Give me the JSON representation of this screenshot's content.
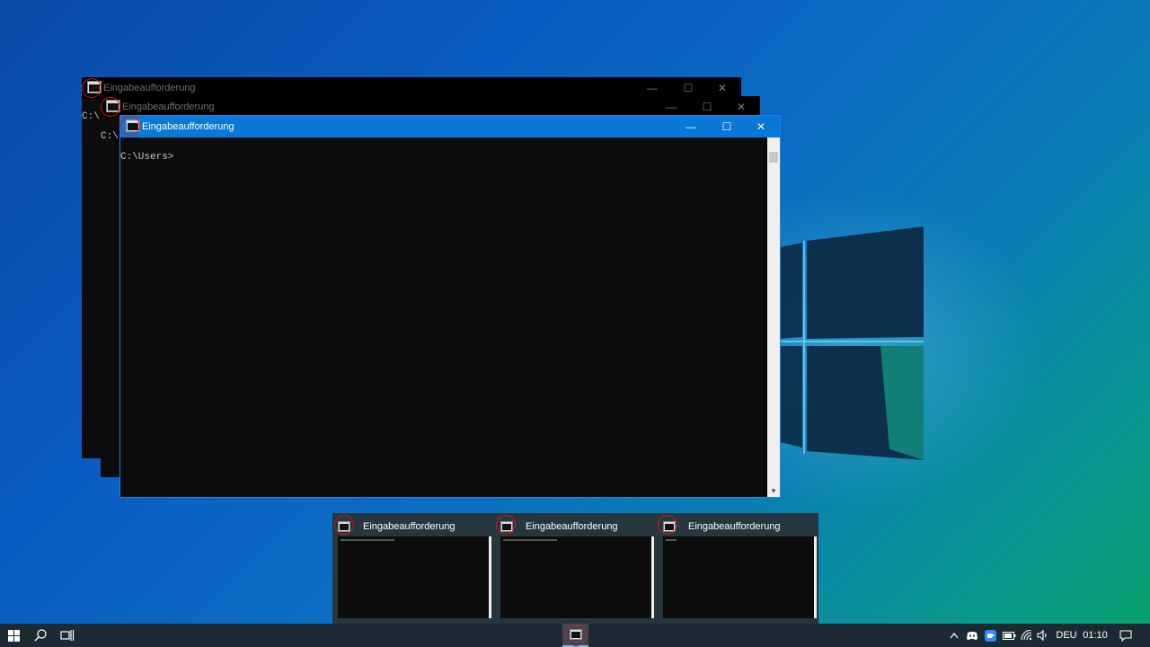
{
  "windows": [
    {
      "title": "Eingabeaufforderung",
      "content": "C:\\"
    },
    {
      "title": "Eingabeaufforderung",
      "content": "C:\\"
    },
    {
      "title": "Eingabeaufforderung",
      "content": "C:\\Users>"
    }
  ],
  "window_controls": {
    "minimize": "—",
    "maximize": "☐",
    "close": "✕"
  },
  "preview": {
    "items": [
      {
        "title": "Eingabeaufforderung"
      },
      {
        "title": "Eingabeaufforderung"
      },
      {
        "title": "Eingabeaufforderung"
      }
    ]
  },
  "taskbar": {
    "start_icon": "windows-start-icon",
    "search_icon": "search-icon",
    "taskview_icon": "task-view-icon",
    "pinned_app_icon": "command-prompt-icon",
    "tray": {
      "language": "DEU",
      "time": "01:10"
    }
  },
  "colors": {
    "active_title": "#0a78d7",
    "highlight_circle": "#dd1111",
    "taskbar": "#1c2b33"
  }
}
